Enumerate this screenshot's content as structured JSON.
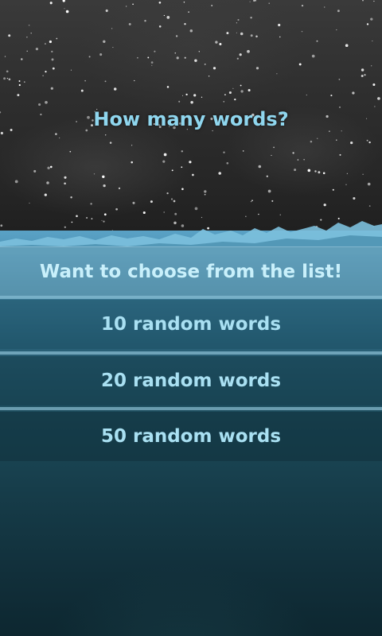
{
  "screen": {
    "title": "How many words?"
  },
  "menu": {
    "choose_from_list": "Want to choose from the list!",
    "random_10": "10 random words",
    "random_20": "20 random words",
    "random_50": "50 random words"
  },
  "colors": {
    "text_accent": "#8fd6ee",
    "sky": "#2e2e2e",
    "sea_top": "#5aa2c6",
    "sea_bottom": "#0d2730"
  }
}
